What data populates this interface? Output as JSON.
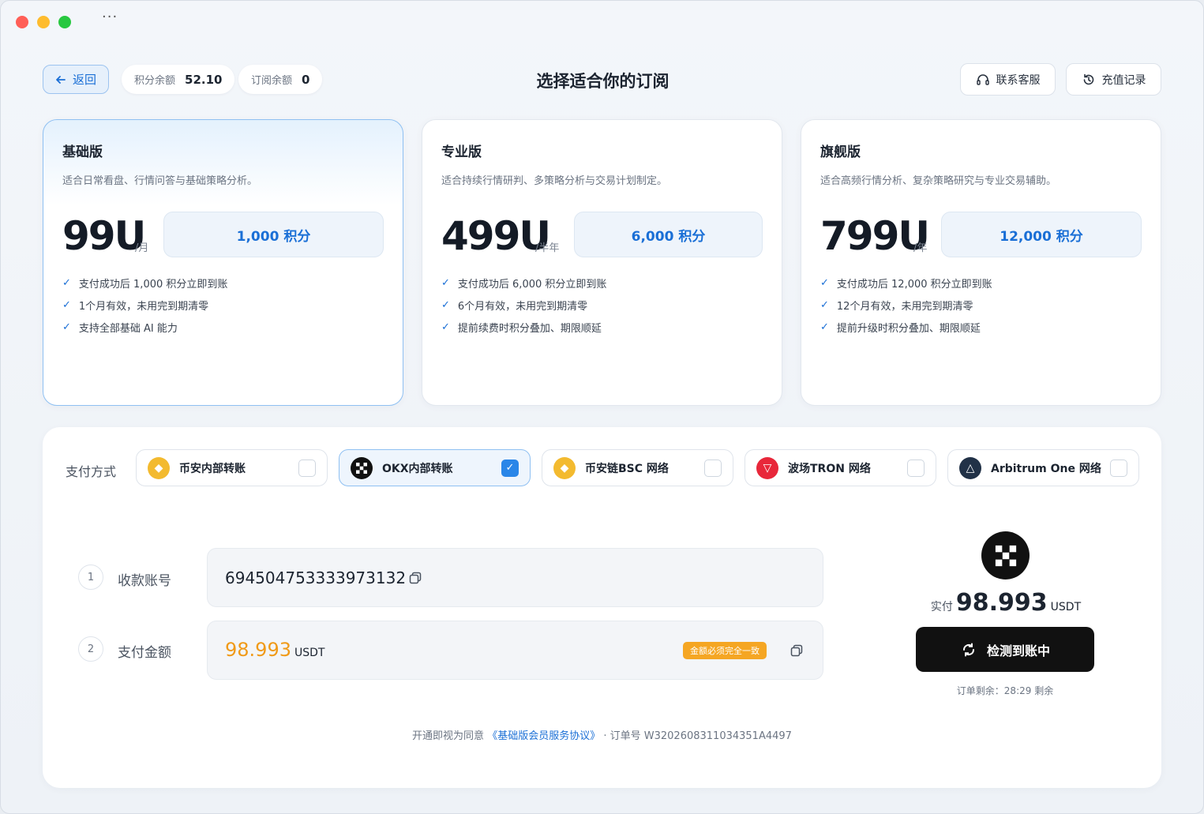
{
  "header": {
    "back_label": "返回",
    "points_balance_label": "积分余额",
    "points_balance_value": "52.10",
    "subscription_balance_label": "订阅余额",
    "subscription_balance_value": "0",
    "title": "选择适合你的订阅",
    "support_label": "联系客服",
    "history_label": "充值记录"
  },
  "plans": [
    {
      "name": "基础版",
      "desc": "适合日常看盘、行情问答与基础策略分析。",
      "price": "99U",
      "period": "/月",
      "points": "1,000 积分",
      "features": [
        "支付成功后 1,000 积分立即到账",
        "1个月有效，未用完到期清零",
        "支持全部基础 AI 能力"
      ],
      "selected": true
    },
    {
      "name": "专业版",
      "desc": "适合持续行情研判、多策略分析与交易计划制定。",
      "price": "499U",
      "period": "/半年",
      "points": "6,000 积分",
      "features": [
        "支付成功后 6,000 积分立即到账",
        "6个月有效，未用完到期清零",
        "提前续费时积分叠加、期限顺延"
      ],
      "selected": false
    },
    {
      "name": "旗舰版",
      "desc": "适合高频行情分析、复杂策略研究与专业交易辅助。",
      "price": "799U",
      "period": "/年",
      "points": "12,000 积分",
      "features": [
        "支付成功后 12,000 积分立即到账",
        "12个月有效，未用完到期清零",
        "提前升级时积分叠加、期限顺延"
      ],
      "selected": false
    }
  ],
  "payment": {
    "label": "支付方式",
    "methods": [
      {
        "label": "币安内部转账",
        "icon": "binance-icon",
        "selected": false
      },
      {
        "label": "OKX内部转账",
        "icon": "okx-icon",
        "selected": true
      },
      {
        "label": "币安链BSC 网络",
        "icon": "bnb-chain-icon",
        "selected": false
      },
      {
        "label": "波场TRON 网络",
        "icon": "tron-icon",
        "selected": false
      },
      {
        "label": "Arbitrum One 网络",
        "icon": "arbitrum-icon",
        "selected": false
      }
    ],
    "step1_num": "1",
    "step1_label": "收款账号",
    "account": "694504753333973132",
    "step2_num": "2",
    "step2_label": "支付金额",
    "amount": "98.993",
    "amount_unit": "USDT",
    "exact_warning": "金额必须完全一致",
    "paid_label": "实付",
    "paid_value": "98.993",
    "paid_unit": "USDT",
    "detect_label": "检测到账中",
    "remain_text": "订单剩余：28:29 剩余",
    "footer_prefix": "开通即视为同意",
    "footer_link": "《基础版会员服务协议》",
    "footer_order": "· 订单号 W3202608311034351A4497"
  },
  "colors": {
    "accent": "#1a6fd6",
    "amount": "#f09a18",
    "warning_badge": "#f5a623",
    "dark_button": "#111111"
  }
}
